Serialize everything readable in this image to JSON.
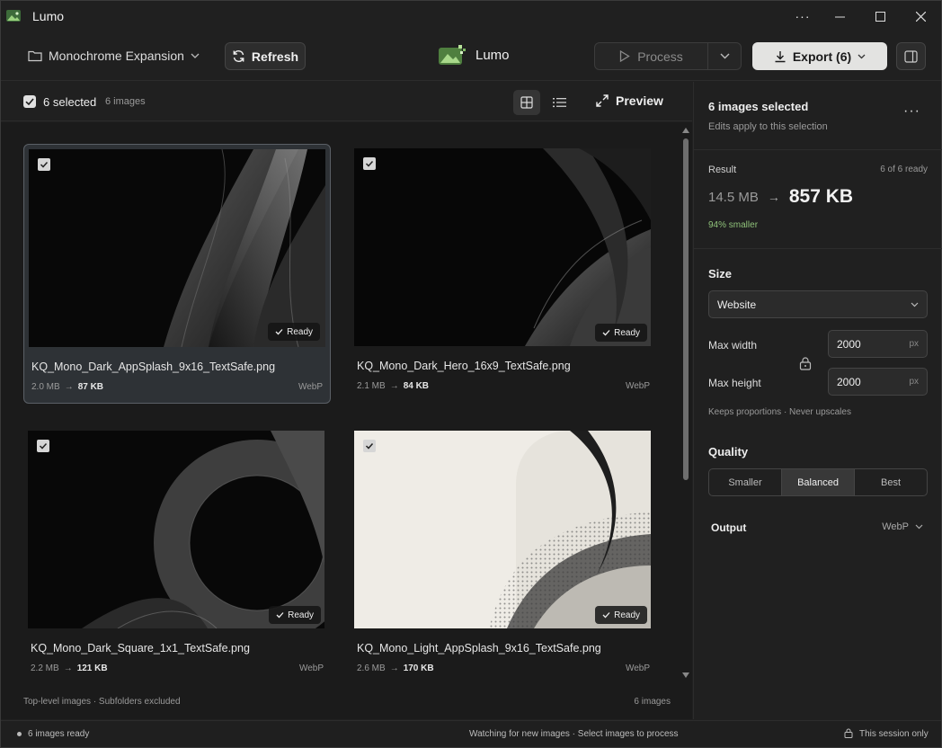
{
  "window": {
    "title": "Lumo"
  },
  "toolbar": {
    "folder_label": "Monochrome Expansion",
    "refresh_label": "Refresh",
    "brand_name": "Lumo",
    "process_label": "Process",
    "export_label": "Export (6)"
  },
  "grid_header": {
    "selected_label": "6 selected",
    "image_count": "6 images",
    "preview_label": "Preview"
  },
  "cards": [
    {
      "name": "KQ_Mono_Dark_AppSplash_9x16_TextSafe.png",
      "from": "2.0 MB",
      "to": "87 KB",
      "format": "WebP",
      "status": "Ready"
    },
    {
      "name": "KQ_Mono_Dark_Hero_16x9_TextSafe.png",
      "from": "2.1 MB",
      "to": "84 KB",
      "format": "WebP",
      "status": "Ready"
    },
    {
      "name": "KQ_Mono_Dark_Square_1x1_TextSafe.png",
      "from": "2.2 MB",
      "to": "121 KB",
      "format": "WebP",
      "status": "Ready"
    },
    {
      "name": "KQ_Mono_Light_AppSplash_9x16_TextSafe.png",
      "from": "2.6 MB",
      "to": "170 KB",
      "format": "WebP",
      "status": "Ready"
    }
  ],
  "grid_footer": {
    "scope": "Top-level images · Subfolders excluded",
    "count": "6 images"
  },
  "side": {
    "title": "6 images selected",
    "subtitle": "Edits apply to this selection",
    "result_label": "Result",
    "result_ready": "6 of 6 ready",
    "result_from": "14.5 MB",
    "result_to": "857 KB",
    "result_saving": "94% smaller",
    "size_heading": "Size",
    "size_preset": "Website",
    "max_width_label": "Max width",
    "max_width_value": "2000",
    "max_height_label": "Max height",
    "max_height_value": "2000",
    "unit": "px",
    "size_note": "Keeps proportions · Never upscales",
    "quality_heading": "Quality",
    "quality_options": [
      "Smaller",
      "Balanced",
      "Best"
    ],
    "output_label": "Output",
    "output_value": "WebP"
  },
  "status": {
    "left": "6 images ready",
    "center": "Watching for new images · Select images to process",
    "right": "This session only"
  },
  "colors": {
    "accent_green": "#8fc27a",
    "export_bg": "#e3e3e1"
  }
}
